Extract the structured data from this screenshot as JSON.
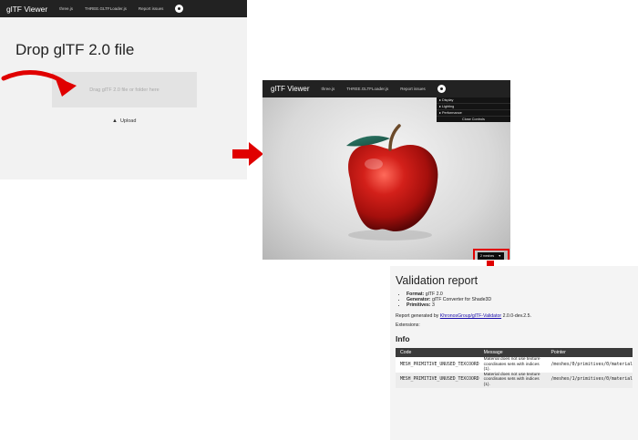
{
  "colors": {
    "accent_arrow": "#e00000",
    "navbar": "#222222",
    "header_row": "#3a3a3a",
    "link": "#1a0dab"
  },
  "drop_page": {
    "brand": "glTF Viewer",
    "nav_links": [
      "three.js",
      "THREE.GLTFLoader.js",
      "Report issues"
    ],
    "github_icon": "github-icon",
    "heading": "Drop glTF 2.0 file",
    "dropzone_text": "Drag glTF 2.0 file or folder here",
    "upload_icon": "upload-icon",
    "upload_label": "Upload"
  },
  "viewer_page": {
    "brand": "glTF Viewer",
    "nav_links": [
      "three.js",
      "THREE.GLTFLoader.js",
      "Report issues"
    ],
    "controls_menu": [
      "Display",
      "Lighting",
      "Performance"
    ],
    "close_controls": "Close Controls",
    "animation_select": "2 meshes",
    "model_description": "apple"
  },
  "validation_report": {
    "title": "Validation report",
    "summary": [
      {
        "label": "Format:",
        "value": "glTF 2.0"
      },
      {
        "label": "Generator:",
        "value": "glTF Converter for Shade3D"
      },
      {
        "label": "Primitives:",
        "value": "3"
      }
    ],
    "generated_prefix": "Report generated by",
    "generated_link": "KhronosGroup/glTF-Validator",
    "generated_version": "2.0.0-dev.2.5.",
    "extensions_label": "Extensions:",
    "info_heading": "Info",
    "table": {
      "headers": [
        "Code",
        "Message",
        "Pointer"
      ],
      "rows": [
        [
          "MESH_PRIMITIVE_UNUSED_TEXCOORD",
          "Material does not use texture coordinates sets with indices (1).",
          "/meshes/0/primitives/0/material"
        ],
        [
          "MESH_PRIMITIVE_UNUSED_TEXCOORD",
          "Material does not use texture coordinates sets with indices (1).",
          "/meshes/1/primitives/0/material"
        ]
      ]
    }
  }
}
